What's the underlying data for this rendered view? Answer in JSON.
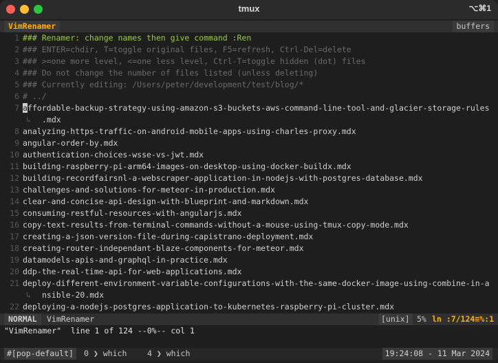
{
  "window": {
    "title": "tmux",
    "shortcut": "⌥⌘1"
  },
  "vim": {
    "tab_name": "VimRenamer",
    "buffers_label": "buffers",
    "lines": [
      {
        "num": "1",
        "text": "### Renamer: change names then give command :Ren"
      },
      {
        "num": "2",
        "text": "### ENTER=chdir, T=toggle original files, F5=refresh, Ctrl-Del=delete"
      },
      {
        "num": "3",
        "text": "### >=one more level, <=one less level, Ctrl-T=toggle hidden (dot) files"
      },
      {
        "num": "4",
        "text": "### Do not change the number of files listed (unless deleting)"
      },
      {
        "num": "5",
        "text": "### Currently editing: /Users/peter/development/test/blog/*"
      },
      {
        "num": "6",
        "text": "# ../"
      },
      {
        "num": "7",
        "cursor_char": "a",
        "text": "ffordable-backup-strategy-using-amazon-s3-buckets-aws-command-line-tool-and-glacier-storage-rules",
        "wrap": ".mdx"
      },
      {
        "num": "8",
        "text": "analyzing-https-traffic-on-android-mobile-apps-using-charles-proxy.mdx"
      },
      {
        "num": "9",
        "text": "angular-order-by.mdx"
      },
      {
        "num": "10",
        "text": "authentication-choices-wsse-vs-jwt.mdx"
      },
      {
        "num": "11",
        "text": "building-raspberry-pi-arm64-images-on-desktop-using-docker-buildx.mdx"
      },
      {
        "num": "12",
        "text": "building-recordfairsnl-a-webscraper-application-in-nodejs-with-postgres-database.mdx"
      },
      {
        "num": "13",
        "text": "challenges-and-solutions-for-meteor-in-production.mdx"
      },
      {
        "num": "14",
        "text": "clear-and-concise-api-design-with-blueprint-and-markdown.mdx"
      },
      {
        "num": "15",
        "text": "consuming-restful-resources-with-angularjs.mdx"
      },
      {
        "num": "16",
        "text": "copy-text-results-from-terminal-commands-without-a-mouse-using-tmux-copy-mode.mdx"
      },
      {
        "num": "17",
        "text": "creating-a-json-version-file-during-capistrano-deployment.mdx"
      },
      {
        "num": "18",
        "text": "creating-router-independant-blaze-components-for-meteor.mdx"
      },
      {
        "num": "19",
        "text": "datamodels-apis-and-graphql-in-practice.mdx"
      },
      {
        "num": "20",
        "text": "ddp-the-real-time-api-for-web-applications.mdx"
      },
      {
        "num": "21",
        "text": "deploy-different-environment-variable-configurations-with-the-same-docker-image-using-combine-in-a",
        "wrap": "nsible-20.mdx"
      },
      {
        "num": "22",
        "text": "deploying-a-nodejs-postgres-application-to-kubernetes-raspberry-pi-cluster.mdx"
      }
    ],
    "wrap_symbol": "↳",
    "status": {
      "mode": "NORMAL",
      "filename": "VimRenamer",
      "fileformat": "[unix]",
      "percent": "5%",
      "position": "ln :7/124≡%:1"
    },
    "message": "\"VimRenamer\"  line 1 of 124 --0%-- col 1"
  },
  "tmux": {
    "session": "#[pop-default]",
    "windows": [
      {
        "index": "0",
        "name": "which"
      },
      {
        "index": "4",
        "name": "which"
      }
    ],
    "separator": "❯",
    "clock": "19:24:08 - 11 Mar 2024"
  }
}
